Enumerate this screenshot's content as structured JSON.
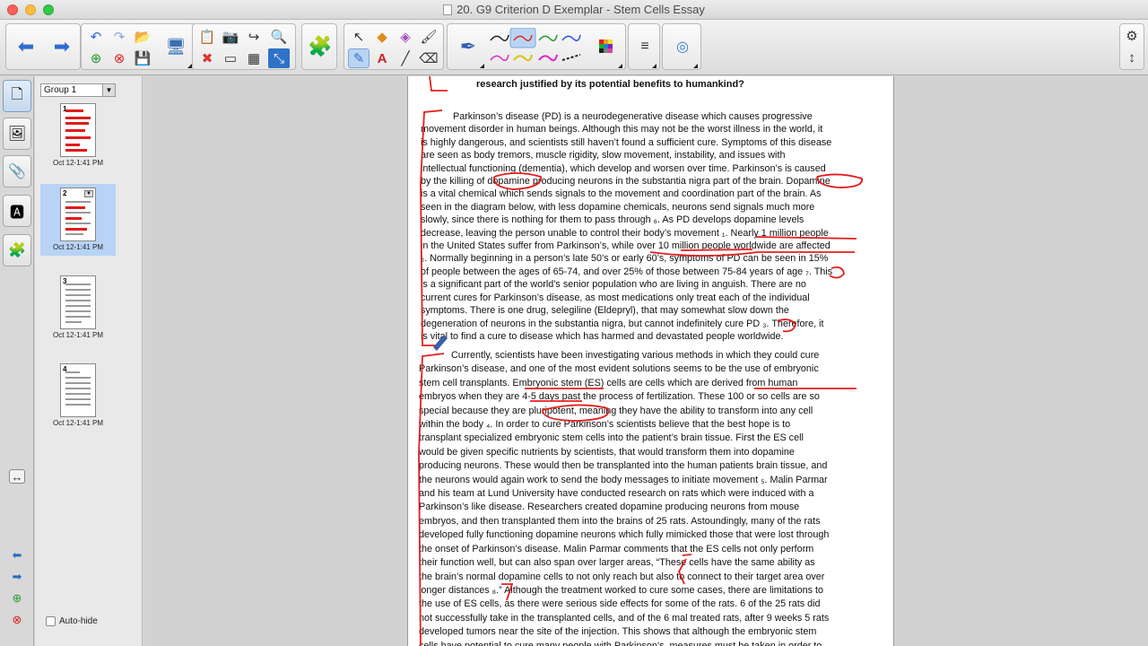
{
  "window": {
    "title": "20. G9 Criterion D Exemplar - Stem Cells Essay"
  },
  "sorter": {
    "group_label": "Group 1",
    "autohide_label": "Auto-hide",
    "pages": [
      {
        "number": "1",
        "date": "Oct 12-1:41 PM"
      },
      {
        "number": "2",
        "date": "Oct 12-1:41 PM"
      },
      {
        "number": "3",
        "date": "Oct 12-1:41 PM"
      },
      {
        "number": "4",
        "date": "Oct 12-1:41 PM"
      }
    ]
  },
  "colors": {
    "ink": "#e41e1e",
    "selection": "#b8d3f5",
    "accent": "#2b6cc4"
  },
  "document": {
    "heading": "research justified by its potential benefits to humankind?",
    "p1": [
      "            Parkinson’s disease (PD) is a neurodegenerative disease which causes progressive",
      "movement disorder in human beings. Although this may not be the worst illness in the world, it",
      "is highly dangerous, and scientists still haven’t found a sufficient cure. Symptoms of this disease",
      "are seen as body tremors, muscle rigidity, slow movement, instability, and issues with",
      "intellectual functioning (dementia), which develop and worsen over time. Parkinson’s is caused",
      "by the killing of dopamine producing neurons in the substantia nigra part of the brain. Dopamine",
      "is a vital chemical which sends signals to the movement and coordination part of the brain. As",
      "seen in the diagram below, with less dopamine chemicals, neurons send signals much more",
      "slowly, since there is nothing for them to pass through ₆. As PD develops dopamine levels",
      "decrease, leaving the person unable to control their body’s movement ₁. Nearly 1 million people",
      "in the United States suffer from Parkinson’s, while over 10 million people worldwide are affected",
      "₂. Normally beginning in a person’s late 50’s or early 60’s, symptoms of PD can be seen in 15%",
      "of people between the ages of 65-74, and over 25% of those between 75-84 years of age ₇. This",
      "is a significant part of the world’s senior population who are living in anguish. There are no",
      "current cures for Parkinson’s disease, as most medications only treat each of the individual",
      "symptoms. There is one drug, selegiline (Eldepryl), that may somewhat slow down the",
      "degeneration of neurons in the substantia nigra, but cannot indefinitely cure PD ₃. Therefore, it",
      "is vital to find a cure to disease which has harmed and devastated people worldwide."
    ],
    "p2": [
      "            Currently, scientists have been investigating various methods in which they could cure",
      "Parkinson’s disease, and one of the most evident solutions seems to be the use of embryonic",
      "stem cell transplants. Embryonic stem (ES) cells are cells which are derived from human",
      "embryos when they are 4-5 days past the process of fertilization. These 100 or so cells are so",
      "special because they are pluripotent, meaning they have the ability to transform into any cell",
      "within the body ₄. In order to cure Parkinson’s scientists believe that the best hope is to",
      "transplant specialized embryonic stem cells into the patient’s brain tissue. First the ES cell",
      "would be given specific nutrients by scientists, that would transform them into dopamine",
      "producing neurons. These would then be transplanted into the human patients brain tissue, and",
      "the neurons would again work to send the body messages to initiate movement ₅. Malin Parmar",
      "and his team at Lund University have conducted research on rats which were induced with a",
      "Parkinson’s like disease. Researchers created dopamine producing neurons from mouse",
      "embryos, and then transplanted them into the brains of 25 rats. Astoundingly, many of the rats",
      "developed fully functioning dopamine neurons which fully mimicked those that were lost through",
      "the onset of Parkinson’s disease. Malin Parmar comments that the ES cells not only perform",
      "their function well, but can also span over larger areas, “These cells have the same ability as",
      "the brain’s normal dopamine cells to not only reach but also to connect to their target area over",
      "longer distances ₈.” Although the treatment worked to cure some cases, there are limitations to",
      "the use of ES cells, as there were serious side effects for some of the rats. 6 of the 25 rats did",
      "not successfully take in the transplanted cells, and of the 6 mal treated rats, after 9 weeks 5 rats",
      "developed tumors near the site of the injection. This shows that although the embryonic stem",
      "cells have potential to cure many people with Parkinson’s, measures must be taken in order to"
    ]
  }
}
